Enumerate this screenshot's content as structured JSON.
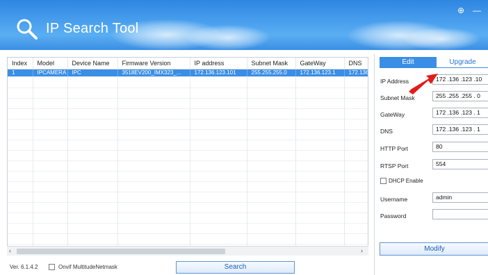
{
  "window": {
    "title": "IP Search Tool",
    "settings_glyph": "⊕",
    "minimize_glyph": "—"
  },
  "table": {
    "columns": [
      "Index",
      "Model",
      "Device Name",
      "Firmware Version",
      "IP address",
      "Subnet Mask",
      "GateWay",
      "DNS"
    ],
    "rows": [
      {
        "index": "1",
        "model": "IPCAMERA",
        "device_name": "IPC",
        "firmware": "3518EV200_IMX323_...",
        "ip": "172.136.123.101",
        "subnet": "255.255.255.0",
        "gateway": "172.136.123.1",
        "dns": "172.136."
      }
    ],
    "scroll_left": "‹",
    "scroll_right": "›"
  },
  "footer": {
    "version": "Ver. 6.1.4.2",
    "onvif_label": "Onvif MultitudeNetmask",
    "onvif_checked": false,
    "search_label": "Search"
  },
  "edit_panel": {
    "tab_edit": "Edit",
    "tab_upgrade": "Upgrade",
    "ip_address_label": "IP Address",
    "ip_address_value": "172 .136 .123 .10",
    "subnet_label": "Subnet Mask",
    "subnet_value": "255 .255 .255 . 0",
    "gateway_label": "GateWay",
    "gateway_value": "172 .136 .123 . 1",
    "dns_label": "DNS",
    "dns_value": "172 .136 .123 . 1",
    "http_port_label": "HTTP Port",
    "http_port_value": "80",
    "rtsp_port_label": "RTSP Port",
    "rtsp_port_value": "554",
    "dhcp_label": "DHCP Enable",
    "dhcp_checked": false,
    "username_label": "Username",
    "username_value": "admin",
    "password_label": "Password",
    "password_value": "",
    "modify_label": "Modify"
  },
  "colors": {
    "header_blue": "#3b8fe4",
    "selection_blue": "#3a8ee6",
    "annotation_arrow": "#e31b1b"
  }
}
